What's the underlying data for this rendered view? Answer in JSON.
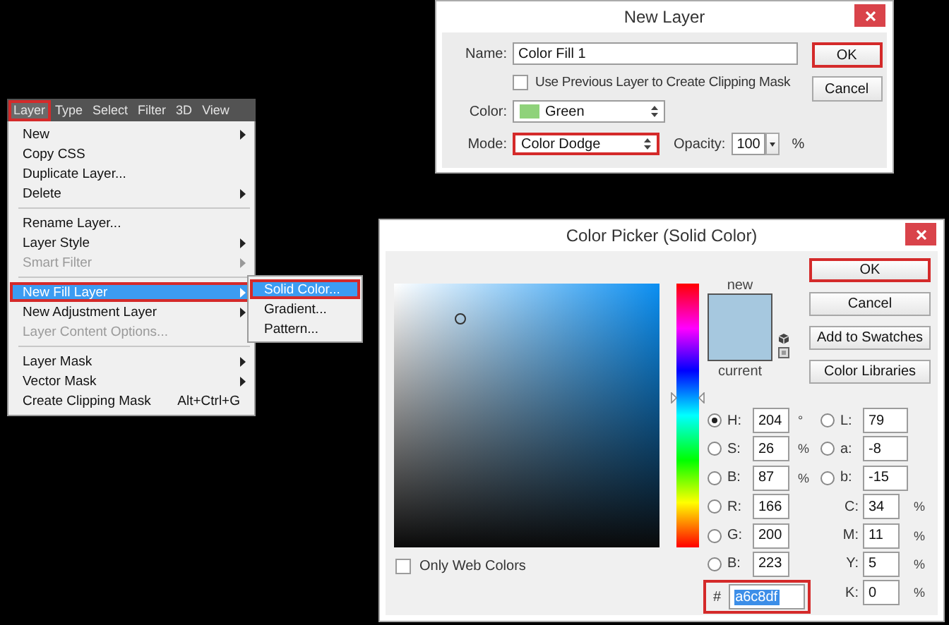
{
  "menu": {
    "menubar": [
      {
        "label": "Layer",
        "selected": true,
        "annotated": true
      },
      {
        "label": "Type",
        "selected": false,
        "annotated": false
      },
      {
        "label": "Select",
        "selected": false,
        "annotated": false
      },
      {
        "label": "Filter",
        "selected": false,
        "annotated": false
      },
      {
        "label": "3D",
        "selected": false,
        "annotated": false
      },
      {
        "label": "View",
        "selected": false,
        "annotated": false
      }
    ],
    "items": [
      {
        "kind": "item",
        "label": "New",
        "submenu": true,
        "disabled": false,
        "highlighted": false,
        "annotated": false
      },
      {
        "kind": "item",
        "label": "Copy CSS",
        "submenu": false,
        "disabled": false,
        "highlighted": false,
        "annotated": false
      },
      {
        "kind": "item",
        "label": "Duplicate Layer...",
        "submenu": false,
        "disabled": false,
        "highlighted": false,
        "annotated": false
      },
      {
        "kind": "item",
        "label": "Delete",
        "submenu": true,
        "disabled": false,
        "highlighted": false,
        "annotated": false
      },
      {
        "kind": "separator"
      },
      {
        "kind": "item",
        "label": "Rename Layer...",
        "submenu": false,
        "disabled": false,
        "highlighted": false,
        "annotated": false
      },
      {
        "kind": "item",
        "label": "Layer Style",
        "submenu": true,
        "disabled": false,
        "highlighted": false,
        "annotated": false
      },
      {
        "kind": "item",
        "label": "Smart Filter",
        "submenu": true,
        "disabled": true,
        "highlighted": false,
        "annotated": false
      },
      {
        "kind": "separator"
      },
      {
        "kind": "item",
        "label": "New Fill Layer",
        "submenu": true,
        "disabled": false,
        "highlighted": true,
        "annotated": true
      },
      {
        "kind": "item",
        "label": "New Adjustment Layer",
        "submenu": true,
        "disabled": false,
        "highlighted": false,
        "annotated": false
      },
      {
        "kind": "item",
        "label": "Layer Content Options...",
        "submenu": false,
        "disabled": true,
        "highlighted": false,
        "annotated": false
      },
      {
        "kind": "separator"
      },
      {
        "kind": "item",
        "label": "Layer Mask",
        "submenu": true,
        "disabled": false,
        "highlighted": false,
        "annotated": false
      },
      {
        "kind": "item",
        "label": "Vector Mask",
        "submenu": true,
        "disabled": false,
        "highlighted": false,
        "annotated": false
      },
      {
        "kind": "item",
        "label": "Create Clipping Mask",
        "shortcut": "Alt+Ctrl+G",
        "submenu": false,
        "disabled": false,
        "highlighted": false,
        "annotated": false
      }
    ],
    "submenu": [
      {
        "label": "Solid Color...",
        "highlighted": true,
        "annotated": true
      },
      {
        "label": "Gradient...",
        "highlighted": false,
        "annotated": false
      },
      {
        "label": "Pattern...",
        "highlighted": false,
        "annotated": false
      }
    ]
  },
  "new_layer": {
    "title": "New Layer",
    "name_label": "Name:",
    "name_value": "Color Fill 1",
    "clip_checkbox": {
      "label": "Use Previous Layer to Create Clipping Mask",
      "checked": false
    },
    "color_label": "Color:",
    "color_value": "Green",
    "color": "#8fd27a",
    "mode_label": "Mode:",
    "mode_value": "Color Dodge",
    "mode_annotated": true,
    "opacity_label": "Opacity:",
    "opacity_value": "100",
    "opacity_unit": "%",
    "buttons": [
      {
        "label": "OK",
        "annotated": true
      },
      {
        "label": "Cancel",
        "annotated": false
      }
    ]
  },
  "color_picker": {
    "title": "Color Picker (Solid Color)",
    "new_label": "new",
    "current_label": "current",
    "buttons": [
      {
        "label": "OK",
        "annotated": true
      },
      {
        "label": "Cancel",
        "annotated": false
      },
      {
        "label": "Add to Swatches",
        "annotated": false
      },
      {
        "label": "Color Libraries",
        "annotated": false
      }
    ],
    "web_colors": {
      "label": "Only Web Colors",
      "checked": false
    },
    "hue_slider": {
      "level": 0.567
    },
    "left_fields": [
      {
        "kind": "radio",
        "label": "H:",
        "value": "204",
        "unit": "°",
        "selected": true
      },
      {
        "kind": "radio",
        "label": "S:",
        "value": "26",
        "unit": "%",
        "selected": false
      },
      {
        "kind": "radio",
        "label": "B:",
        "value": "87",
        "unit": "%",
        "selected": false
      },
      {
        "kind": "radio",
        "label": "R:",
        "value": "166",
        "selected": false
      },
      {
        "kind": "radio",
        "label": "G:",
        "value": "200",
        "selected": false
      },
      {
        "kind": "radio",
        "label": "B:",
        "value": "223",
        "selected": false
      },
      {
        "kind": "hex",
        "label": "#",
        "value": "a6c8df",
        "text_selected": true,
        "annotated": true
      }
    ],
    "right_fields": [
      {
        "kind": "radio",
        "label": "L:",
        "value": "79",
        "selected": false
      },
      {
        "kind": "radio",
        "label": "a:",
        "value": "-8",
        "selected": false
      },
      {
        "kind": "radio",
        "label": "b:",
        "value": "-15",
        "selected": false
      },
      {
        "kind": "plain",
        "label": "C:",
        "value": "34",
        "unit": "%"
      },
      {
        "kind": "plain",
        "label": "M:",
        "value": "11",
        "unit": "%"
      },
      {
        "kind": "plain",
        "label": "Y:",
        "value": "5",
        "unit": "%"
      },
      {
        "kind": "plain",
        "label": "K:",
        "value": "0",
        "unit": "%"
      }
    ]
  }
}
